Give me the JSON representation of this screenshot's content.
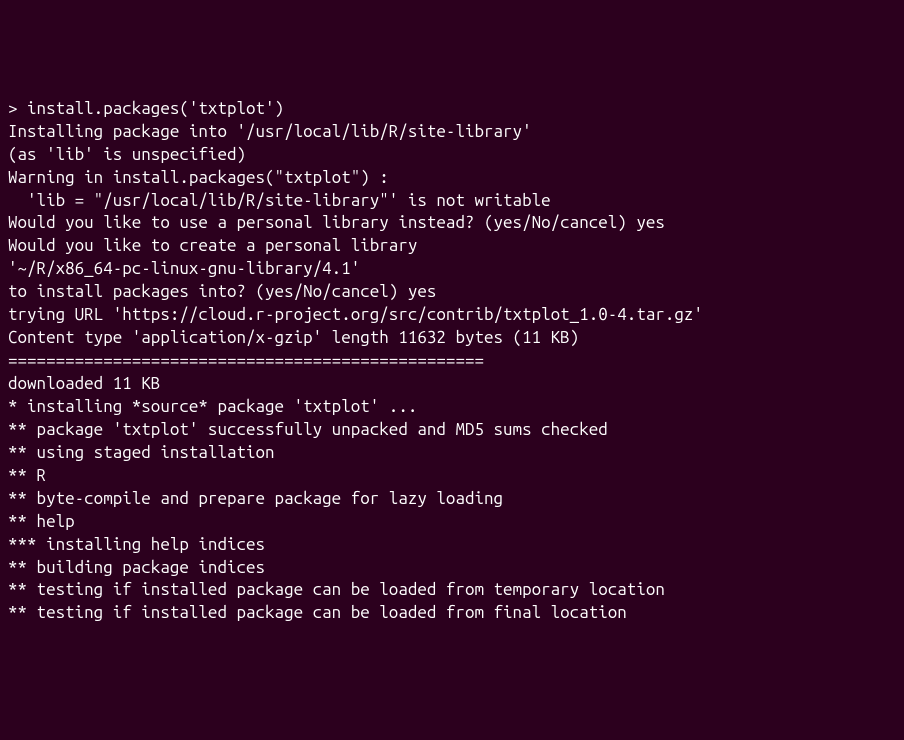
{
  "terminal": {
    "lines": [
      "> install.packages('txtplot')",
      "Installing package into '/usr/local/lib/R/site-library'",
      "(as 'lib' is unspecified)",
      "Warning in install.packages(\"txtplot\") :",
      "  'lib = \"/usr/local/lib/R/site-library\"' is not writable",
      "Would you like to use a personal library instead? (yes/No/cancel) yes",
      "Would you like to create a personal library",
      "'~/R/x86_64-pc-linux-gnu-library/4.1'",
      "to install packages into? (yes/No/cancel) yes",
      "trying URL 'https://cloud.r-project.org/src/contrib/txtplot_1.0-4.tar.gz'",
      "Content type 'application/x-gzip' length 11632 bytes (11 KB)",
      "==================================================",
      "downloaded 11 KB",
      "",
      "* installing *source* package 'txtplot' ...",
      "** package 'txtplot' successfully unpacked and MD5 sums checked",
      "** using staged installation",
      "** R",
      "** byte-compile and prepare package for lazy loading",
      "** help",
      "*** installing help indices",
      "** building package indices",
      "** testing if installed package can be loaded from temporary location",
      "** testing if installed package can be loaded from final location"
    ]
  }
}
